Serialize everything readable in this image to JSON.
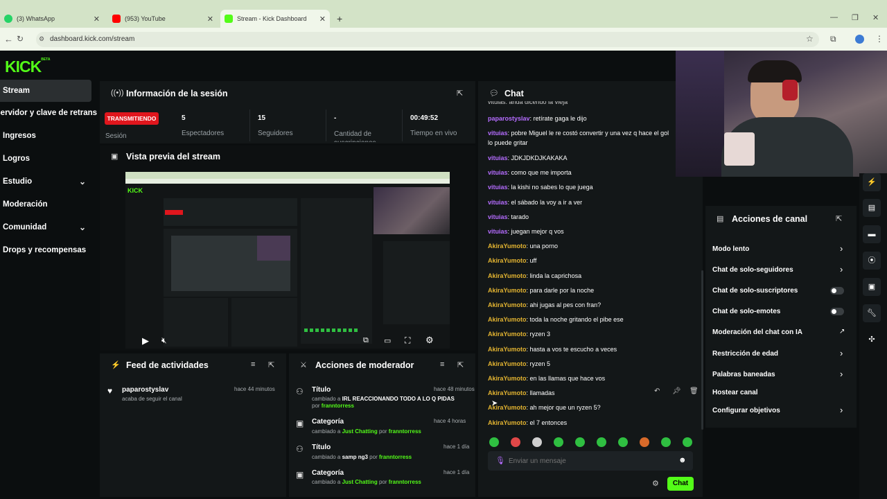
{
  "browser": {
    "tabs": [
      {
        "label": "(3) WhatsApp"
      },
      {
        "label": "(953) YouTube"
      },
      {
        "label": "Stream - Kick Dashboard"
      }
    ],
    "url": "dashboard.kick.com/stream",
    "colors": {
      "whatsapp": "#25d366",
      "youtube": "#ff0000",
      "kick": "#53fc18"
    }
  },
  "brand": {
    "logo": "KICK",
    "badge": "BETA"
  },
  "sidebar": {
    "items": [
      {
        "label": "Stream"
      },
      {
        "label": "Servidor y clave de retransmisión"
      },
      {
        "label": "Ingresos"
      },
      {
        "label": "Logros"
      },
      {
        "label": "Estudio"
      },
      {
        "label": "Moderación"
      },
      {
        "label": "Comunidad"
      },
      {
        "label": "Drops y recompensas"
      }
    ]
  },
  "session": {
    "title": "Información de la sesión",
    "status": "TRANSMITIENDO",
    "status_label": "Sesión",
    "stats": [
      {
        "value": "5",
        "label": "Espectadores"
      },
      {
        "value": "15",
        "label": "Seguidores"
      },
      {
        "value": "-",
        "label": "Cantidad de suscripciones"
      },
      {
        "value": "00:49:52",
        "label": "Tiempo en vivo"
      }
    ]
  },
  "preview": {
    "title": "Vista previa del stream"
  },
  "feed": {
    "title": "Feed de actividades",
    "items": [
      {
        "user": "paparostyslav",
        "action": "acaba de seguir el canal",
        "time": "hace 44 minutos"
      }
    ]
  },
  "mod": {
    "title": "Acciones de moderador",
    "items": [
      {
        "title": "Título",
        "pre": "cambiado a",
        "value": "IRL REACCIONANDO TODO A LO Q PIDAS",
        "by": "por",
        "user": "franntorress",
        "time": "hace 48 minutos"
      },
      {
        "title": "Categoría",
        "pre": "cambiado a",
        "value": "Just Chatting",
        "by": "por",
        "user": "franntorress",
        "time": "hace 4 horas"
      },
      {
        "title": "Título",
        "pre": "cambiado a",
        "value": "samp ng3",
        "by": "por",
        "user": "franntorress",
        "time": "hace 1 día"
      },
      {
        "title": "Categoría",
        "pre": "cambiado a",
        "value": "Just Chatting",
        "by": "por",
        "user": "franntorress",
        "time": "hace 1 día"
      }
    ]
  },
  "chat": {
    "title": "Chat",
    "messages": [
      {
        "user": "paparostyslav",
        "text": "retírate gaga le dijo",
        "color": "purple"
      },
      {
        "user": "vituias",
        "text": "pobre Miguel le re costó convertir y una vez q hace el gol",
        "text2": "lo puede gritar",
        "color": "purple"
      },
      {
        "user": "vituias",
        "text": "JDKJDKDJKAKAKA",
        "color": "purple"
      },
      {
        "user": "vituias",
        "text": "como que me importa",
        "color": "purple"
      },
      {
        "user": "vituias",
        "text": "la kishi no sabes lo que juega",
        "color": "purple"
      },
      {
        "user": "vituias",
        "text": "el sábado la voy a ir a ver",
        "color": "purple"
      },
      {
        "user": "vituias",
        "text": "tarado",
        "color": "purple"
      },
      {
        "user": "vituias",
        "text": "juegan mejor q vos",
        "color": "purple"
      },
      {
        "user": "AkiraYumoto",
        "text": "una porno",
        "color": "gold"
      },
      {
        "user": "AkiraYumoto",
        "text": "uff",
        "color": "gold"
      },
      {
        "user": "AkiraYumoto",
        "text": "linda la caprichosa",
        "color": "gold"
      },
      {
        "user": "AkiraYumoto",
        "text": "para darle por la noche",
        "color": "gold"
      },
      {
        "user": "AkiraYumoto",
        "text": "ahi jugas al pes con fran?",
        "color": "gold"
      },
      {
        "user": "AkiraYumoto",
        "text": "toda la noche gritando el pibe ese",
        "color": "gold"
      },
      {
        "user": "AkiraYumoto",
        "text": "ryzen 3",
        "color": "gold"
      },
      {
        "user": "AkiraYumoto",
        "text": "hasta a vos te escucho a veces",
        "color": "gold"
      },
      {
        "user": "AkiraYumoto",
        "text": "ryzen 5",
        "color": "gold"
      },
      {
        "user": "AkiraYumoto",
        "text": "en las llamas que hace vos",
        "color": "gold"
      },
      {
        "user": "AkiraYumoto",
        "text": "llamadas",
        "color": "gold"
      },
      {
        "user": "AkiraYumoto",
        "text": "ah mejor que un ryzen 5?",
        "color": "gold"
      },
      {
        "user": "AkiraYumoto",
        "text": "el 7 entonces",
        "color": "gold"
      }
    ],
    "input_placeholder": "Enviar un mensaje",
    "send_label": "Chat"
  },
  "channel": {
    "title": "Acciones de canal",
    "items": [
      {
        "label": "Modo lento",
        "control": "chevron"
      },
      {
        "label": "Chat de solo-seguidores",
        "control": "chevron"
      },
      {
        "label": "Chat de solo-suscriptores",
        "control": "toggle"
      },
      {
        "label": "Chat de solo-emotes",
        "control": "toggle"
      },
      {
        "label": "Moderación del chat con IA",
        "control": "external"
      },
      {
        "label": "Restricción de edad",
        "control": "chevron"
      },
      {
        "label": "Palabras baneadas",
        "control": "chevron"
      },
      {
        "label": "Hostear canal",
        "control": "none"
      },
      {
        "label": "Configurar objetivos",
        "control": "chevron"
      }
    ]
  }
}
